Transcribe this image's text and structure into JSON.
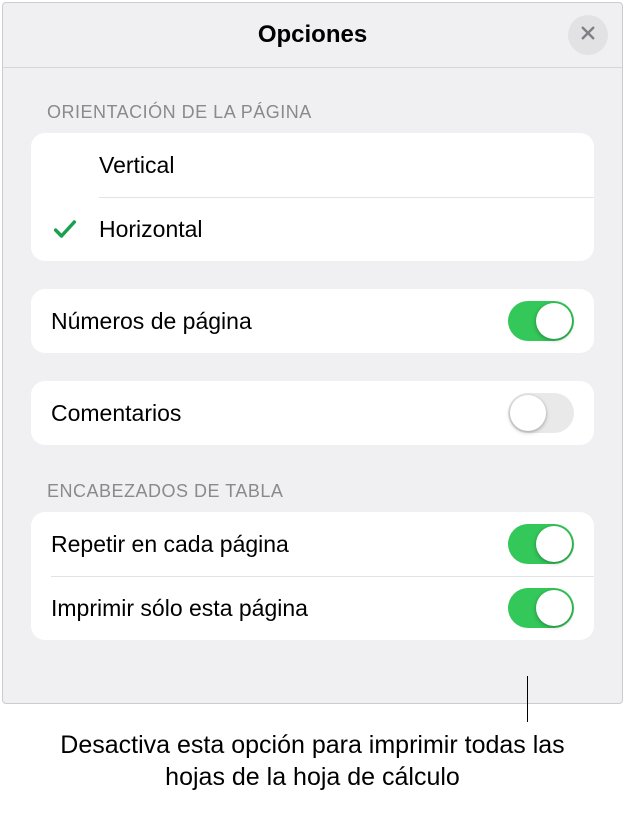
{
  "header": {
    "title": "Opciones"
  },
  "orientation": {
    "header": "ORIENTACIÓN DE LA PÁGINA",
    "items": [
      {
        "label": "Vertical",
        "selected": false
      },
      {
        "label": "Horizontal",
        "selected": true
      }
    ]
  },
  "pageNumbers": {
    "label": "Números de página",
    "enabled": true
  },
  "comments": {
    "label": "Comentarios",
    "enabled": false
  },
  "tableHeaders": {
    "header": "ENCABEZADOS DE TABLA",
    "repeat": {
      "label": "Repetir en cada página",
      "enabled": true
    },
    "printOnly": {
      "label": "Imprimir sólo esta página",
      "enabled": true
    }
  },
  "callout": {
    "text": "Desactiva esta opción para imprimir todas las hojas de la hoja de cálculo"
  },
  "colors": {
    "toggleOn": "#34c759",
    "toggleOff": "#e9e9ea"
  }
}
